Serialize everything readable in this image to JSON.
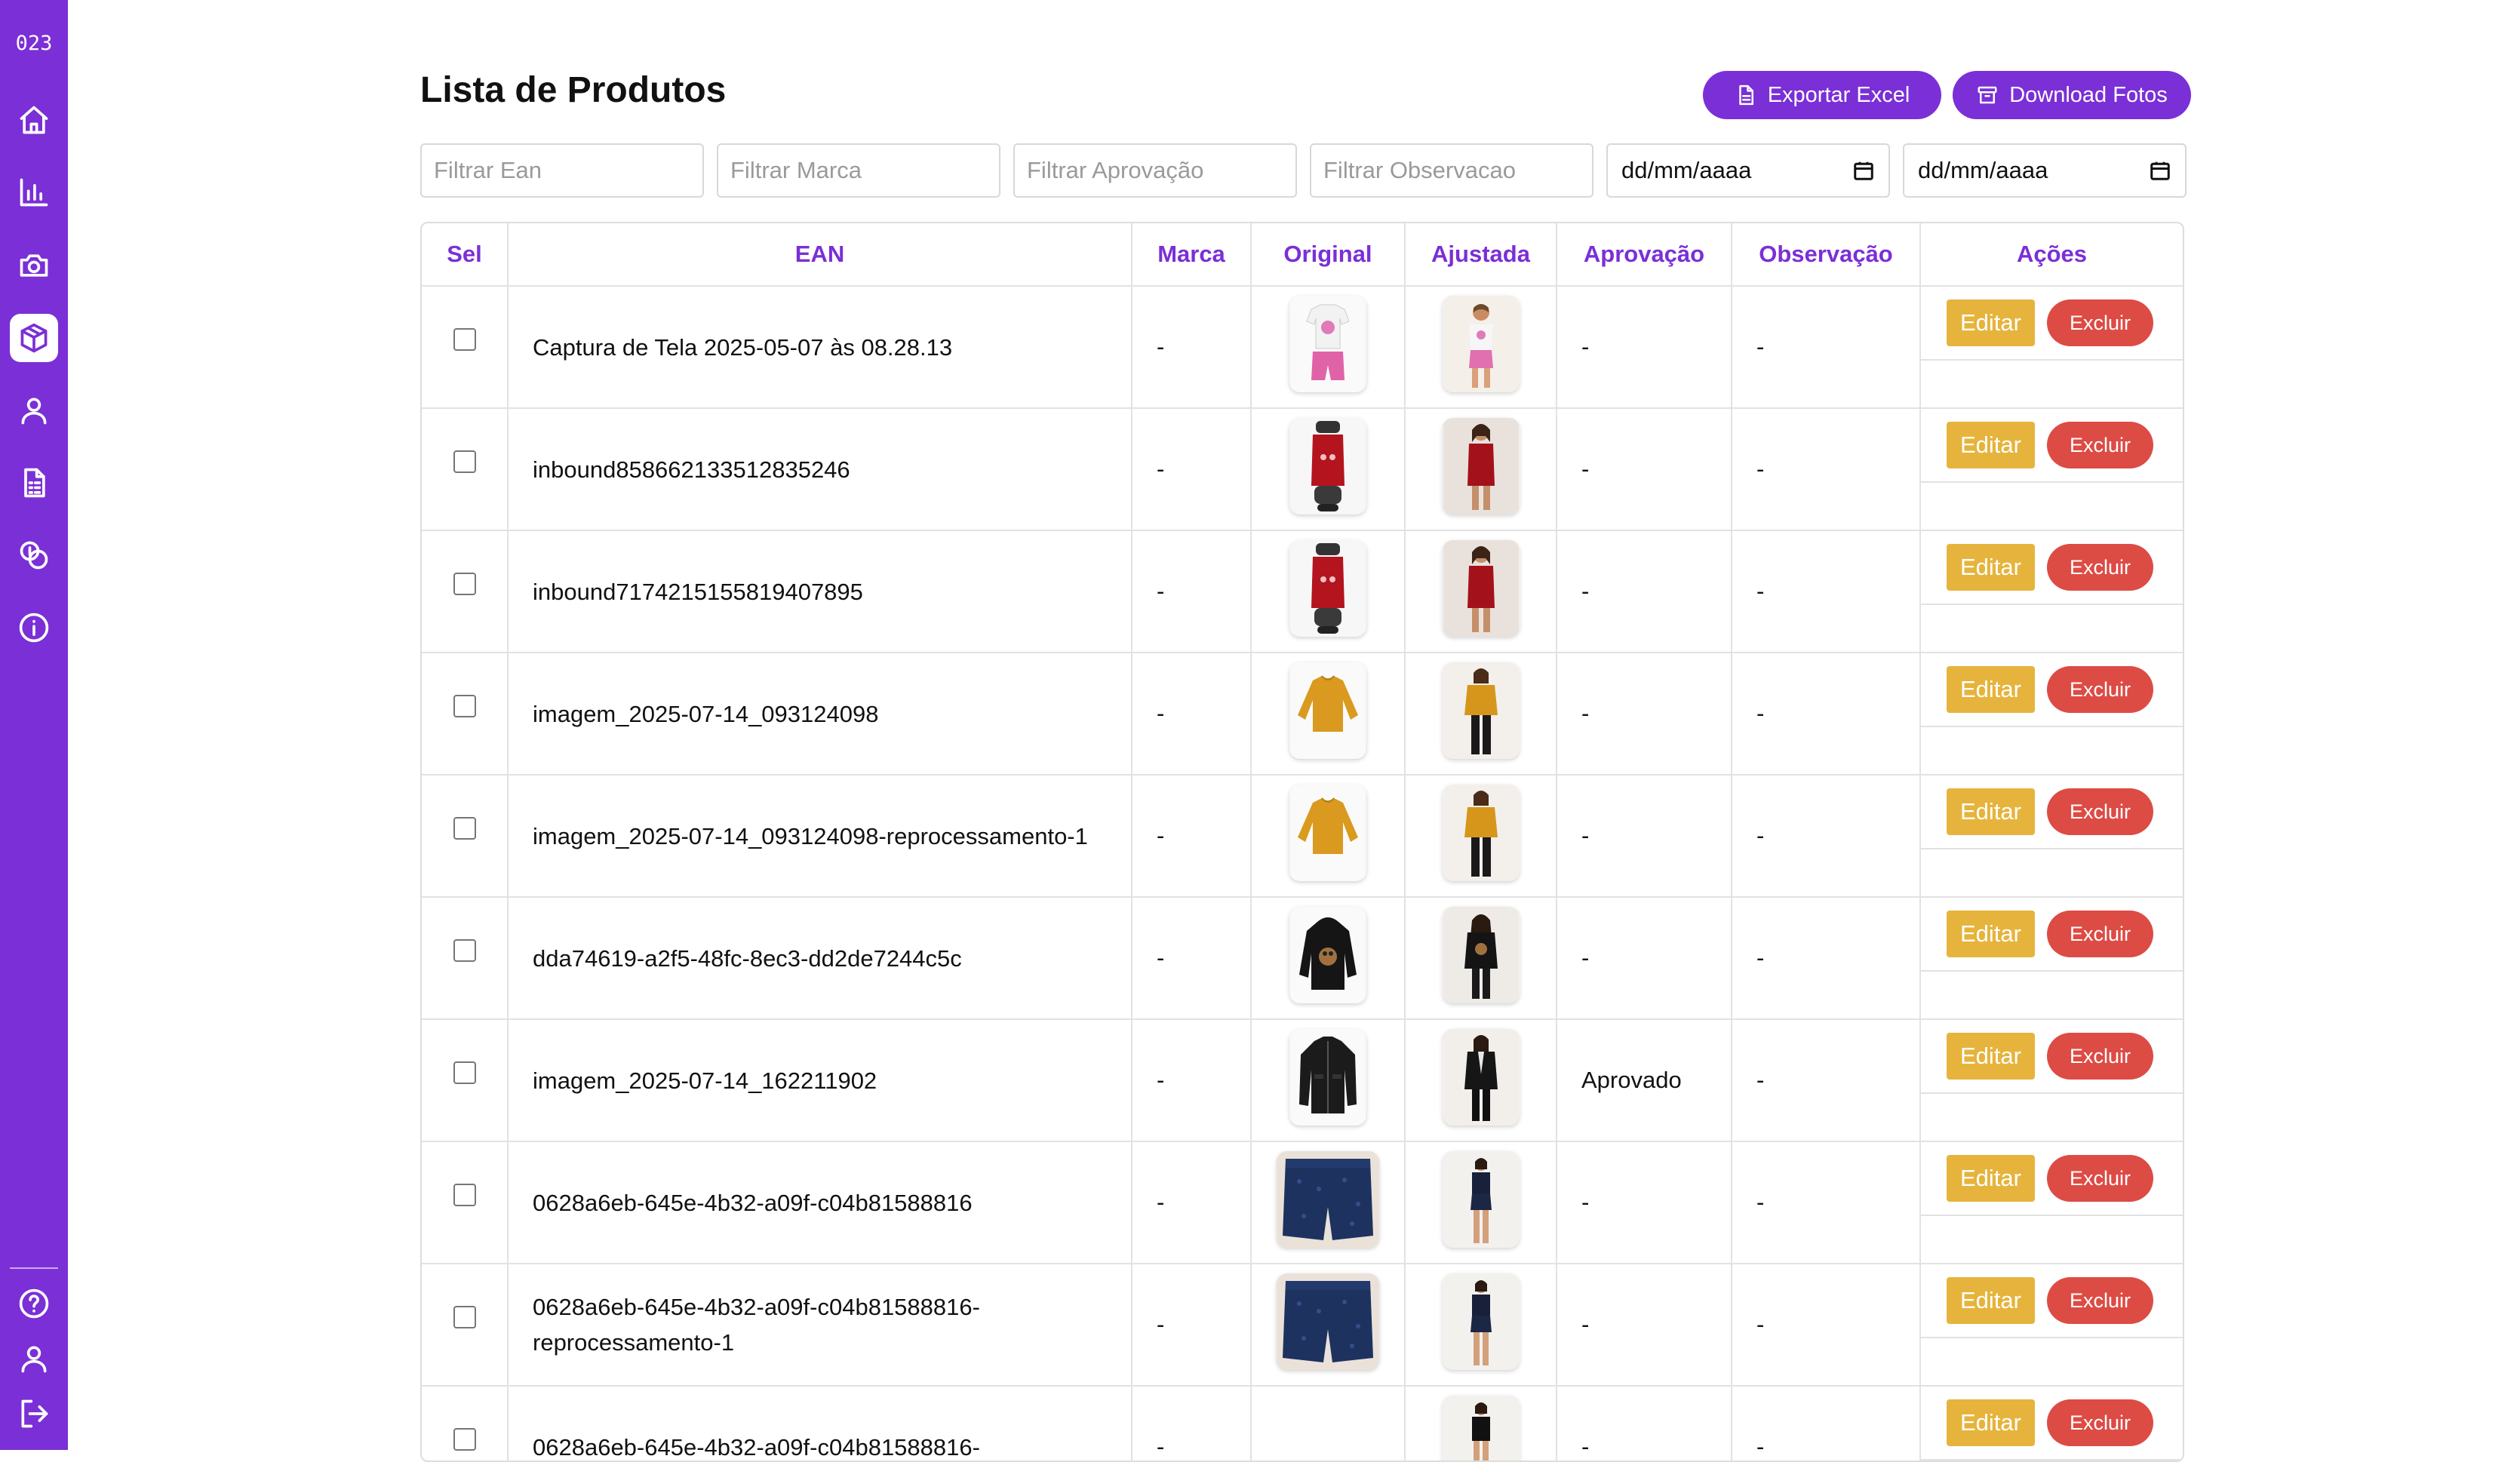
{
  "app": {
    "logo_text": "023"
  },
  "sidebar": {
    "items": [
      {
        "icon": "home-icon",
        "active": false
      },
      {
        "icon": "bar-chart-icon",
        "active": false
      },
      {
        "icon": "camera-icon",
        "active": false
      },
      {
        "icon": "box-icon",
        "active": true
      },
      {
        "icon": "user-icon",
        "active": false
      },
      {
        "icon": "document-icon",
        "active": false
      },
      {
        "icon": "coins-icon",
        "active": false
      },
      {
        "icon": "info-icon",
        "active": false
      }
    ],
    "bottom_items": [
      {
        "icon": "help-icon"
      },
      {
        "icon": "profile-icon"
      },
      {
        "icon": "logout-icon"
      }
    ]
  },
  "header": {
    "title": "Lista de Produtos",
    "export_label": "Exportar Excel",
    "download_label": "Download Fotos"
  },
  "filters": {
    "ean_placeholder": "Filtrar Ean",
    "marca_placeholder": "Filtrar Marca",
    "aprovacao_placeholder": "Filtrar Aprovação",
    "observacao_placeholder": "Filtrar Observacao",
    "date_from": "dd/mm/aaaa",
    "date_to": "dd/mm/aaaa"
  },
  "table": {
    "columns": [
      "Sel",
      "EAN",
      "Marca",
      "Original",
      "Ajustada",
      "Aprovação",
      "Observação",
      "Ações"
    ],
    "edit_label": "Editar",
    "delete_label": "Excluir",
    "rows": [
      {
        "ean": "Captura de Tela 2025-05-07 às 08.28.13",
        "marca": "-",
        "aprovacao": "-",
        "observacao": "-",
        "original": "kids-tee-shorts",
        "ajustada": "kids-model"
      },
      {
        "ean": "inbound858662133512835246",
        "marca": "-",
        "aprovacao": "-",
        "observacao": "-",
        "original": "red-top-mannequin",
        "ajustada": "red-top-model"
      },
      {
        "ean": "inbound7174215155819407895",
        "marca": "-",
        "aprovacao": "-",
        "observacao": "-",
        "original": "red-top-mannequin",
        "ajustada": "red-top-model"
      },
      {
        "ean": "imagem_2025-07-14_093124098",
        "marca": "-",
        "aprovacao": "-",
        "observacao": "-",
        "original": "mustard-sweater",
        "ajustada": "mustard-sweater-model"
      },
      {
        "ean": "imagem_2025-07-14_093124098-reprocessamento-1",
        "marca": "-",
        "aprovacao": "-",
        "observacao": "-",
        "original": "mustard-sweater",
        "ajustada": "mustard-sweater-model"
      },
      {
        "ean": "dda74619-a2f5-48fc-8ec3-dd2de7244c5c",
        "marca": "-",
        "aprovacao": "-",
        "observacao": "-",
        "original": "black-hoodie",
        "ajustada": "black-hoodie-model"
      },
      {
        "ean": "imagem_2025-07-14_162211902",
        "marca": "-",
        "aprovacao": "Aprovado",
        "observacao": "-",
        "original": "black-jacket",
        "ajustada": "black-jacket-model"
      },
      {
        "ean": "0628a6eb-645e-4b32-a09f-c04b81588816",
        "marca": "-",
        "aprovacao": "-",
        "observacao": "-",
        "original": "navy-shorts",
        "ajustada": "navy-set-model"
      },
      {
        "ean": "0628a6eb-645e-4b32-a09f-c04b81588816-reprocessamento-1",
        "marca": "-",
        "aprovacao": "-",
        "observacao": "-",
        "original": "navy-shorts",
        "ajustada": "navy-set-model"
      },
      {
        "ean": "0628a6eb-645e-4b32-a09f-c04b81588816-",
        "marca": "-",
        "aprovacao": "-",
        "observacao": "-",
        "original": "none",
        "ajustada": "black-set-model"
      }
    ]
  },
  "colors": {
    "brand": "#7b2fd6",
    "edit": "#e6b43c",
    "delete": "#dd4b45"
  }
}
